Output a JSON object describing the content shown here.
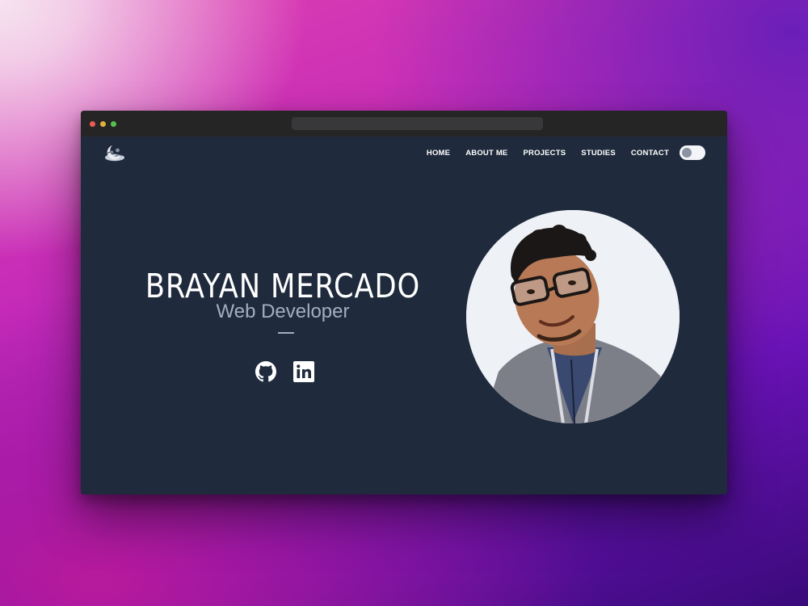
{
  "nav": {
    "logo_icon": "moon-logo-icon",
    "links": [
      {
        "label": "HOME"
      },
      {
        "label": "ABOUT ME"
      },
      {
        "label": "PROJECTS"
      },
      {
        "label": "STUDIES"
      },
      {
        "label": "CONTACT"
      }
    ],
    "theme_toggle": {
      "state": "off"
    }
  },
  "hero": {
    "name": "BRAYAN MERCADO",
    "role": "Web Developer",
    "social": [
      {
        "icon": "github-icon"
      },
      {
        "icon": "linkedin-icon"
      }
    ]
  },
  "profile_photo": {
    "icon": "profile-photo"
  },
  "colors": {
    "page_background": "#1f2a3c",
    "accent_text": "#a3aec3",
    "titlebar": "#252526",
    "close": "#ee5b52",
    "minimize": "#e2b13b",
    "zoom": "#55c04b"
  }
}
